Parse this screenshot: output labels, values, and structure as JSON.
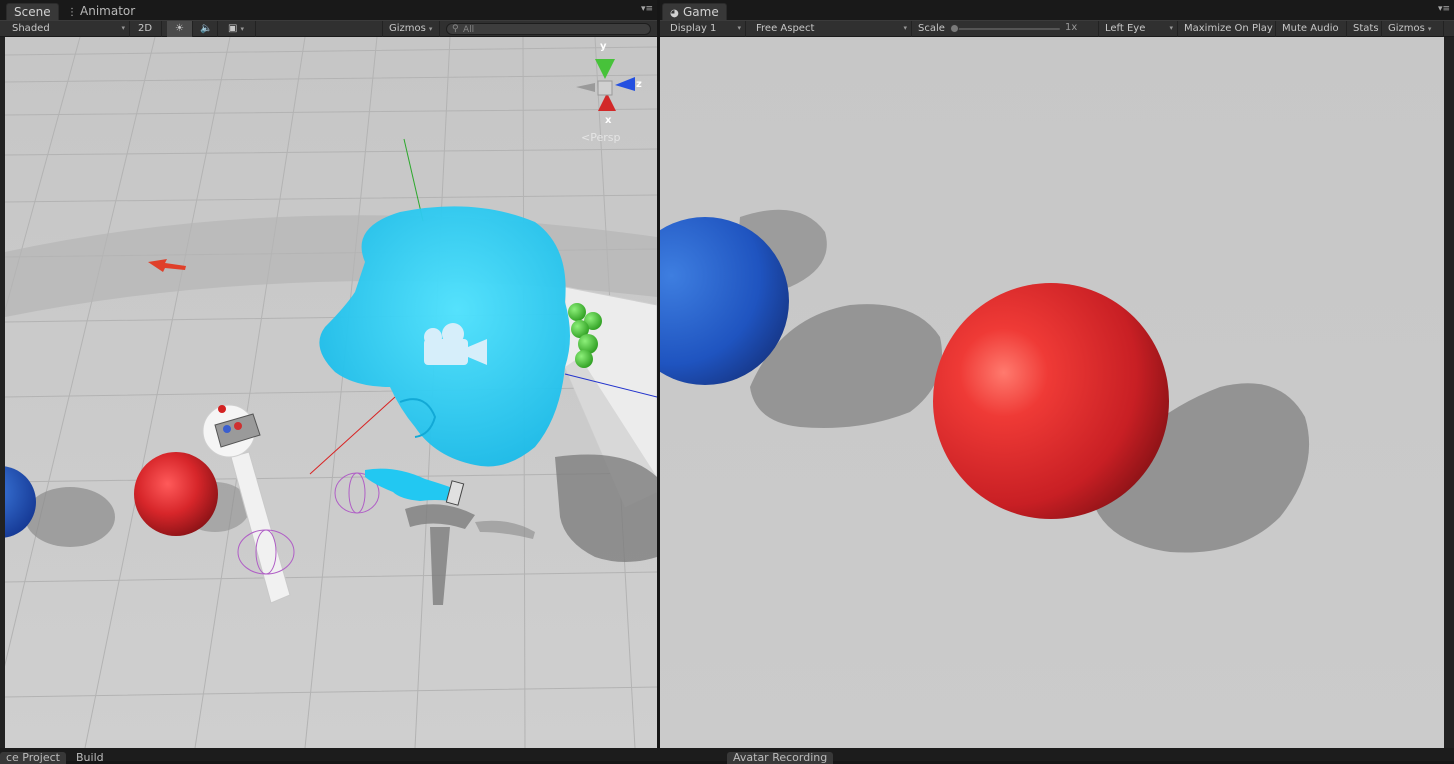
{
  "scene": {
    "tabs": [
      {
        "label": "Scene",
        "active": true,
        "icon": "grid-icon"
      },
      {
        "label": "Animator",
        "active": false,
        "icon": "animator-icon"
      }
    ],
    "toolbar": {
      "shading_mode": "Shaded",
      "mode_2d": "2D",
      "gizmos_label": "Gizmos",
      "search_placeholder": "All"
    },
    "orientation_gizmo": {
      "y_label": "y",
      "z_label": "z",
      "x_label": "x",
      "projection": "Persp"
    }
  },
  "game": {
    "tab": {
      "label": "Game",
      "icon": "pacman-icon"
    },
    "toolbar": {
      "display": "Display 1",
      "aspect": "Free Aspect",
      "scale_label": "Scale",
      "scale_value": "1x",
      "eye": "Left Eye",
      "maximize": "Maximize On Play",
      "mute": "Mute Audio",
      "stats": "Stats",
      "gizmos": "Gizmos"
    }
  },
  "bottom": {
    "left_tabs": [
      "ce Project",
      "Build"
    ],
    "right_tabs": [
      "Avatar Recording"
    ]
  },
  "colors": {
    "accent_red": "#d7262a",
    "accent_blue": "#2356c2",
    "head_cyan": "#22d3f7",
    "green": "#45c83a"
  }
}
